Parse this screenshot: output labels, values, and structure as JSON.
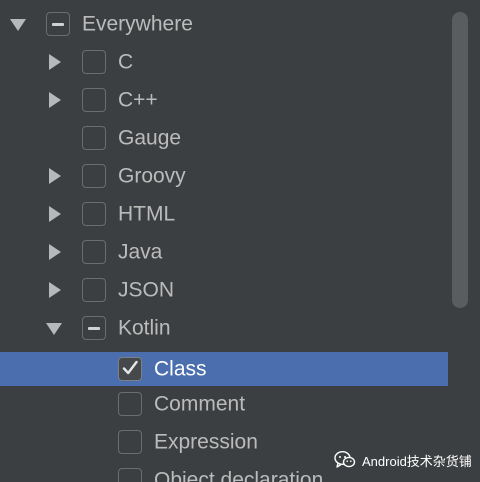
{
  "tree": {
    "rows": [
      {
        "label": "Everywhere",
        "level": 0,
        "arrow": "expanded",
        "check": "partial",
        "selected": false
      },
      {
        "label": "C",
        "level": 1,
        "arrow": "collapsed",
        "check": "unchecked",
        "selected": false
      },
      {
        "label": "C++",
        "level": 1,
        "arrow": "collapsed",
        "check": "unchecked",
        "selected": false
      },
      {
        "label": "Gauge",
        "level": 1,
        "arrow": "none",
        "check": "unchecked",
        "selected": false
      },
      {
        "label": "Groovy",
        "level": 1,
        "arrow": "collapsed",
        "check": "unchecked",
        "selected": false
      },
      {
        "label": "HTML",
        "level": 1,
        "arrow": "collapsed",
        "check": "unchecked",
        "selected": false
      },
      {
        "label": "Java",
        "level": 1,
        "arrow": "collapsed",
        "check": "unchecked",
        "selected": false
      },
      {
        "label": "JSON",
        "level": 1,
        "arrow": "collapsed",
        "check": "unchecked",
        "selected": false
      },
      {
        "label": "Kotlin",
        "level": 1,
        "arrow": "expanded",
        "check": "partial",
        "selected": false
      },
      {
        "label": "Class",
        "level": 2,
        "arrow": "none",
        "check": "checked",
        "selected": true
      },
      {
        "label": "Comment",
        "level": 2,
        "arrow": "none",
        "check": "unchecked",
        "selected": false
      },
      {
        "label": "Expression",
        "level": 2,
        "arrow": "none",
        "check": "unchecked",
        "selected": false
      },
      {
        "label": "Object declaration",
        "level": 2,
        "arrow": "none",
        "check": "unchecked",
        "selected": false
      }
    ]
  },
  "watermark": {
    "text": "Android技术杂货铺",
    "icon": "wechat-icon"
  },
  "colors": {
    "background": "#3c3f41",
    "selection": "#4b6eaf",
    "text": "#bbbbbb",
    "selected_text": "#ffffff",
    "arrow": "#b6b8ba",
    "checkbox_border": "#6b6d6f",
    "scrollbar": "#5a5d5f"
  }
}
